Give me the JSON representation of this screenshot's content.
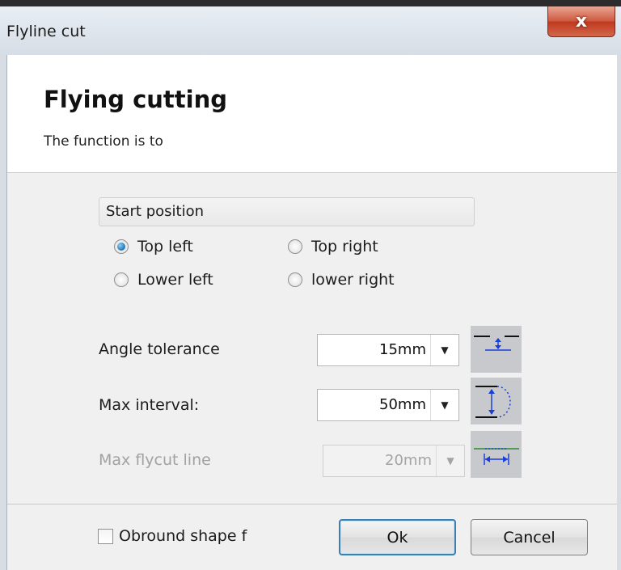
{
  "window": {
    "title": "Flyline cut",
    "close_glyph": "x"
  },
  "header": {
    "title": "Flying cutting",
    "subtitle": "The function is to"
  },
  "start_position": {
    "label": "Start position",
    "options": [
      "Top left",
      "Top right",
      "Lower left",
      "lower right"
    ],
    "selected": "Top left"
  },
  "fields": [
    {
      "label": "Angle tolerance",
      "value": "15mm",
      "enabled": true,
      "icon": "angle-tolerance-icon"
    },
    {
      "label": "Max interval:",
      "value": "50mm",
      "enabled": true,
      "icon": "max-interval-icon"
    },
    {
      "label": "Max flycut line",
      "value": "20mm",
      "enabled": false,
      "icon": "max-flycut-line-icon"
    }
  ],
  "obround": {
    "label": "Obround shape f",
    "checked": false
  },
  "buttons": {
    "ok": "Ok",
    "cancel": "Cancel"
  },
  "colors": {
    "accent_blue": "#1a3fd6",
    "diagram_green": "#2a8a2a",
    "close_red": "#c7452b"
  }
}
